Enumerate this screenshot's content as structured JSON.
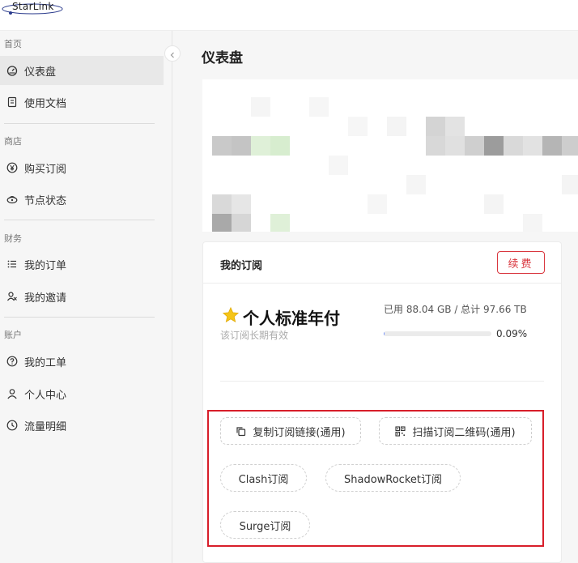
{
  "app": {
    "logo_text": "StarLink"
  },
  "colors": {
    "accent_red": "#d9363e",
    "highlight_red": "#d81e2a",
    "active_bg": "#e8e8e8",
    "progress_fill": "#6e8efb"
  },
  "sidebar": {
    "sections": [
      {
        "title": "首页",
        "items": [
          {
            "label": "仪表盘",
            "icon": "dashboard-icon",
            "active": true
          },
          {
            "label": "使用文档",
            "icon": "document-icon",
            "active": false
          }
        ]
      },
      {
        "title": "商店",
        "items": [
          {
            "label": "购买订阅",
            "icon": "yen-icon",
            "active": false
          },
          {
            "label": "节点状态",
            "icon": "node-icon",
            "active": false
          }
        ]
      },
      {
        "title": "财务",
        "items": [
          {
            "label": "我的订单",
            "icon": "list-icon",
            "active": false
          },
          {
            "label": "我的邀请",
            "icon": "invite-icon",
            "active": false
          }
        ]
      },
      {
        "title": "账户",
        "items": [
          {
            "label": "我的工单",
            "icon": "help-icon",
            "active": false
          },
          {
            "label": "个人中心",
            "icon": "user-icon",
            "active": false
          },
          {
            "label": "流量明细",
            "icon": "clock-icon",
            "active": false
          }
        ]
      }
    ]
  },
  "main": {
    "page_title": "仪表盘",
    "subscription": {
      "card_title": "我的订阅",
      "renew_label": "续费",
      "plan_name": "个人标准年付",
      "plan_desc": "该订阅长期有效",
      "usage_text": "已用 88.04 GB / 总计 97.66 TB",
      "usage_percent_text": "0.09%",
      "usage_fraction": 0.0009,
      "buttons": {
        "copy_link": "复制订阅链接(通用)",
        "scan_qr": "扫描订阅二维码(通用)",
        "clash": "Clash订阅",
        "shadowrocket": "ShadowRocket订阅",
        "surge": "Surge订阅"
      }
    }
  }
}
